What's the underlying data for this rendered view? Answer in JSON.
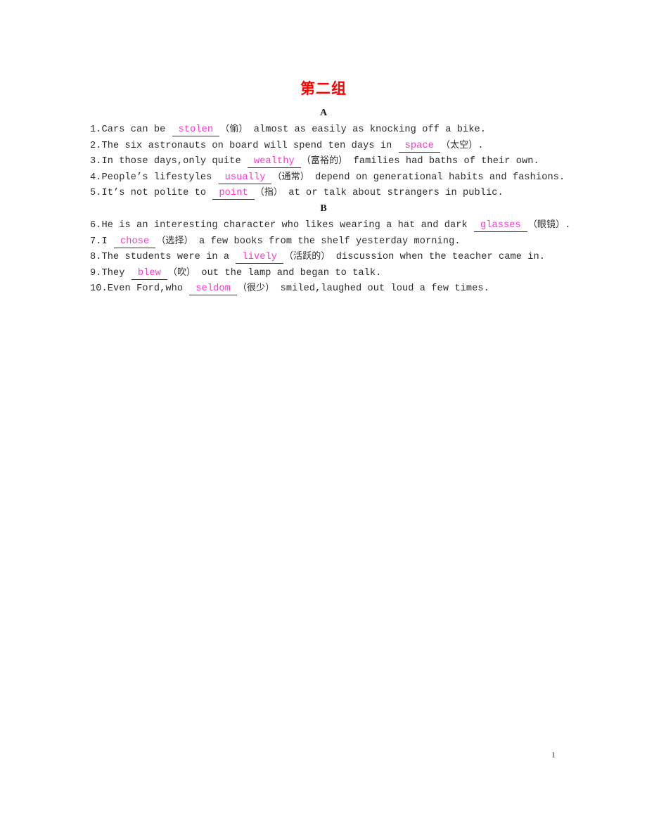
{
  "document": {
    "title": "第二组",
    "title_color": "#ff0000",
    "answer_color": "#ff33cc",
    "page_number": "1"
  },
  "sections": [
    {
      "heading": "A",
      "questions": [
        {
          "number": "1.",
          "before": "Cars can be ",
          "answer": "stolen",
          "hint": "（偷）",
          "after": " almost as easily as knocking off a bike."
        },
        {
          "number": "2.",
          "before": "The six astronauts on board will spend ten days in ",
          "answer": "space",
          "hint": "（太空）",
          "after": "."
        },
        {
          "number": "3.",
          "before": "In those days,only quite ",
          "answer": "wealthy",
          "hint": "（富裕的）",
          "after": " families had baths of their own."
        },
        {
          "number": "4.",
          "before": "People’s lifestyles ",
          "answer": "usually",
          "hint": "（通常）",
          "after": " depend on generational habits and fashions."
        },
        {
          "number": "5.",
          "before": "It’s not polite to ",
          "answer": "point",
          "hint": "（指）",
          "after": " at or talk about strangers in public."
        }
      ]
    },
    {
      "heading": "B",
      "questions": [
        {
          "number": "6.",
          "before": "He is an interesting character who likes wearing a hat and dark ",
          "answer": "glasses",
          "hint": "（眼镜）",
          "after": "."
        },
        {
          "number": "7.",
          "before": "I ",
          "answer": "chose",
          "hint": "（选择）",
          "after": " a few books from the shelf yesterday morning."
        },
        {
          "number": "8.",
          "before": "The students were in a ",
          "answer": "lively",
          "hint": "（活跃的）",
          "after": " discussion when the teacher came in."
        },
        {
          "number": "9.",
          "before": "They ",
          "answer": "blew",
          "hint": "（吹）",
          "after": " out the lamp and began to talk."
        },
        {
          "number": "10.",
          "before": "Even Ford,who ",
          "answer": "seldom",
          "hint": "（很少）",
          "after": " smiled,laughed out loud a few times."
        }
      ]
    }
  ]
}
